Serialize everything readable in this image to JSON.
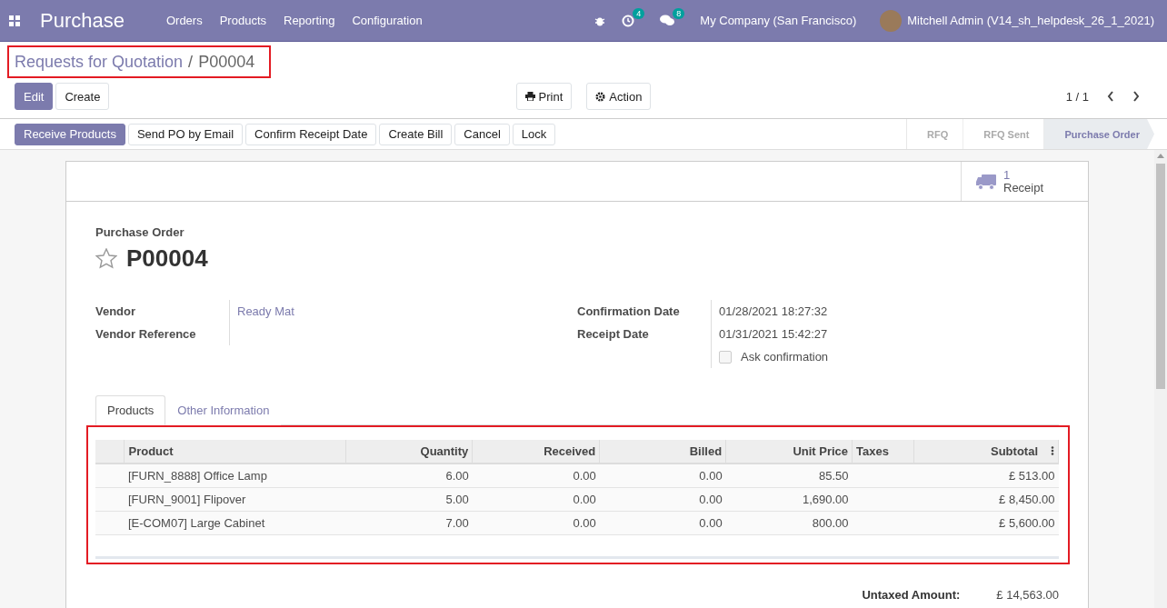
{
  "navbar": {
    "app": "Purchase",
    "menu": [
      "Orders",
      "Products",
      "Reporting",
      "Configuration"
    ],
    "activity_count": "4",
    "message_count": "8",
    "company": "My Company (San Francisco)",
    "user": "Mitchell Admin (V14_sh_helpdesk_26_1_2021)"
  },
  "breadcrumb": {
    "parent": "Requests for Quotation",
    "separator": "/",
    "current": "P00004",
    "highlighted": true
  },
  "buttons": [
    {
      "label": "Edit",
      "primary": true
    },
    {
      "label": "Create",
      "primary": false
    }
  ],
  "center_buttons": [
    {
      "label": "Print",
      "kind": "print"
    },
    {
      "label": "Action",
      "kind": "gear"
    }
  ],
  "pager": "1 / 1",
  "header_buttons": [
    {
      "label": "Receive Products",
      "primary": true
    },
    {
      "label": "Send PO by Email",
      "primary": false
    },
    {
      "label": "Confirm Receipt Date",
      "primary": false
    },
    {
      "label": "Create Bill",
      "primary": false
    },
    {
      "label": "Cancel",
      "primary": false
    },
    {
      "label": "Lock",
      "primary": false
    }
  ],
  "stages": [
    {
      "label": "RFQ",
      "selected": false
    },
    {
      "label": "RFQ Sent",
      "selected": false
    },
    {
      "label": "Purchase Order",
      "selected": true
    }
  ],
  "smart_button": {
    "count": "1",
    "label": "Receipt"
  },
  "title_label": "Purchase Order",
  "name": "P00004",
  "starred": false,
  "left_fields": [
    {
      "label": "Vendor",
      "value": "Ready Mat"
    },
    {
      "label": "Vendor Reference"
    }
  ],
  "right_fields": [
    {
      "label": "Confirmation Date",
      "value": "01/28/2021 18:27:32"
    },
    {
      "label": "Receipt Date",
      "value": "01/31/2021 15:42:27"
    }
  ],
  "ask_confirmation": {
    "label": "Ask confirmation",
    "checked": false
  },
  "tabs": [
    {
      "label": "Products",
      "selected": true
    },
    {
      "label": "Other Information",
      "selected": false
    }
  ],
  "table": {
    "highlighted": true,
    "columns": [
      "Product",
      "Quantity",
      "Received",
      "Billed",
      "Unit Price",
      "Taxes",
      "Subtotal"
    ],
    "rows": [
      [
        "[FURN_8888] Office Lamp",
        "6.00",
        "0.00",
        "0.00",
        "85.50",
        "",
        "£ 513.00"
      ],
      [
        "[FURN_9001] Flipover",
        "5.00",
        "0.00",
        "0.00",
        "1,690.00",
        "",
        "£ 8,450.00"
      ],
      [
        "[E-COM07] Large Cabinet",
        "7.00",
        "0.00",
        "0.00",
        "800.00",
        "",
        "£ 5,600.00"
      ]
    ]
  },
  "totals": [
    {
      "label": "Untaxed Amount:",
      "value": "£ 14,563.00"
    }
  ]
}
